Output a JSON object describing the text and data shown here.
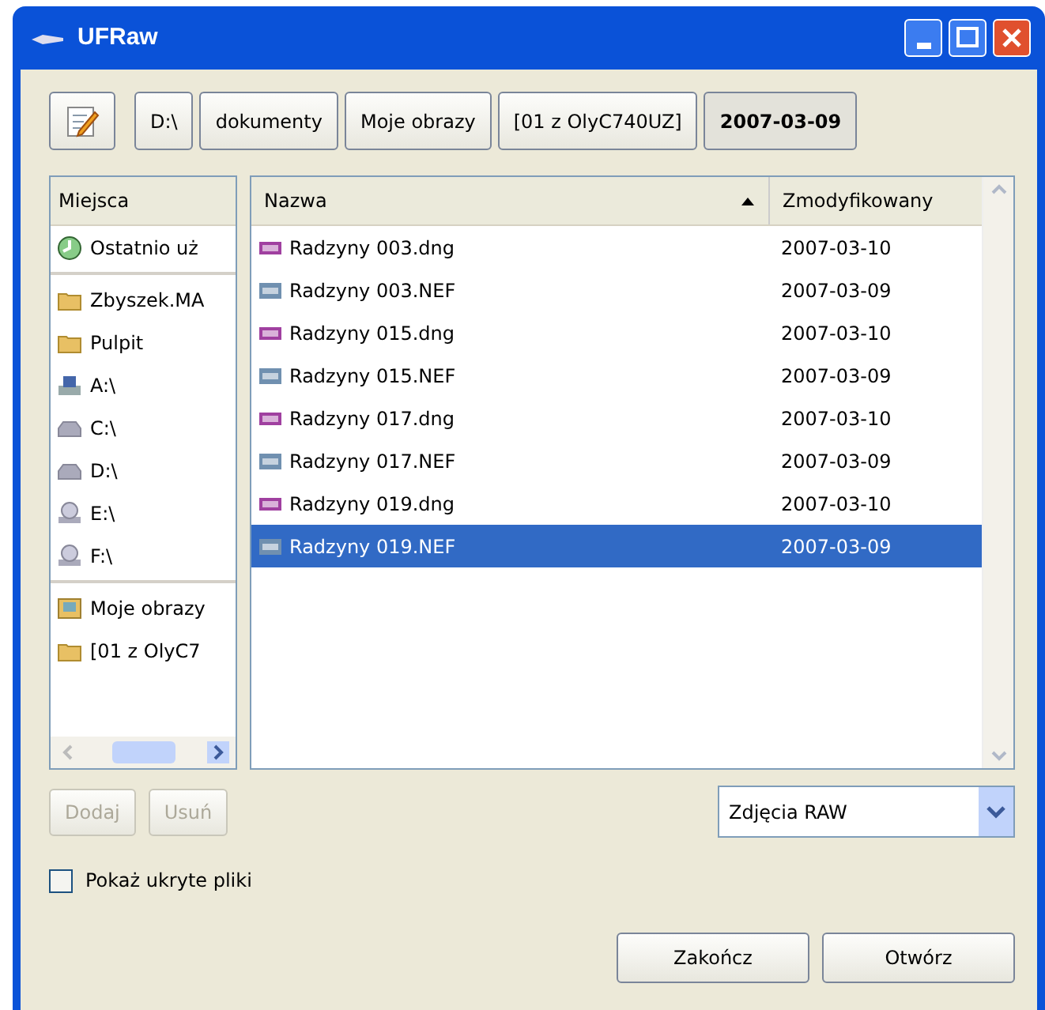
{
  "window": {
    "title": "UFRaw"
  },
  "path_bar": [
    {
      "label": "D:\\",
      "selected": false
    },
    {
      "label": "dokumenty",
      "selected": false
    },
    {
      "label": "Moje obrazy",
      "selected": false
    },
    {
      "label": "[01 z OlyC740UZ]",
      "selected": false
    },
    {
      "label": "2007-03-09",
      "selected": true
    }
  ],
  "places": {
    "header": "Miejsca",
    "groups": [
      [
        {
          "label": "Ostatnio uż",
          "kind": "recent"
        }
      ],
      [
        {
          "label": "Zbyszek.MA",
          "kind": "folder"
        },
        {
          "label": "Pulpit",
          "kind": "folder"
        },
        {
          "label": "A:\\",
          "kind": "floppy"
        },
        {
          "label": "C:\\",
          "kind": "drive"
        },
        {
          "label": "D:\\",
          "kind": "drive"
        },
        {
          "label": "E:\\",
          "kind": "cdrom"
        },
        {
          "label": "F:\\",
          "kind": "cdrom"
        }
      ],
      [
        {
          "label": "Moje obrazy",
          "kind": "pictures"
        },
        {
          "label": "[01 z OlyC7",
          "kind": "folder"
        }
      ]
    ]
  },
  "file_list": {
    "columns": [
      "Nazwa",
      "Zmodyfikowany"
    ],
    "rows": [
      {
        "name": "Radzyny 003.dng",
        "modified": "2007-03-10",
        "kind": "dng",
        "selected": false
      },
      {
        "name": "Radzyny 003.NEF",
        "modified": "2007-03-09",
        "kind": "nef",
        "selected": false
      },
      {
        "name": "Radzyny 015.dng",
        "modified": "2007-03-10",
        "kind": "dng",
        "selected": false
      },
      {
        "name": "Radzyny 015.NEF",
        "modified": "2007-03-09",
        "kind": "nef",
        "selected": false
      },
      {
        "name": "Radzyny 017.dng",
        "modified": "2007-03-10",
        "kind": "dng",
        "selected": false
      },
      {
        "name": "Radzyny 017.NEF",
        "modified": "2007-03-09",
        "kind": "nef",
        "selected": false
      },
      {
        "name": "Radzyny 019.dng",
        "modified": "2007-03-10",
        "kind": "dng",
        "selected": false
      },
      {
        "name": "Radzyny 019.NEF",
        "modified": "2007-03-09",
        "kind": "nef",
        "selected": true
      }
    ]
  },
  "place_buttons": [
    {
      "label": "Dodaj",
      "disabled": true
    },
    {
      "label": "Usuń",
      "disabled": true
    }
  ],
  "filter": {
    "value": "Zdjęcia RAW"
  },
  "show_hidden": {
    "label": "Pokaż ukryte pliki",
    "checked": false
  },
  "buttons": [
    "Zakończ",
    "Otwórz"
  ]
}
